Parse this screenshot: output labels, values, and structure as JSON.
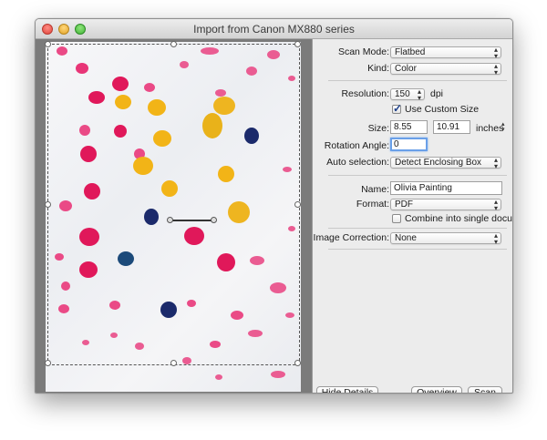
{
  "window": {
    "title": "Import from Canon MX880 series"
  },
  "settings": {
    "scan_mode": {
      "label": "Scan Mode:",
      "value": "Flatbed"
    },
    "kind": {
      "label": "Kind:",
      "value": "Color"
    },
    "resolution": {
      "label": "Resolution:",
      "value": "150",
      "unit": "dpi"
    },
    "use_custom_size": {
      "label": "Use Custom Size",
      "checked": true
    },
    "size": {
      "label": "Size:",
      "width": "8.55",
      "height": "10.91",
      "unit": "inches"
    },
    "rotation_angle": {
      "label": "Rotation Angle:",
      "value": "0"
    },
    "auto_selection": {
      "label": "Auto selection:",
      "value": "Detect Enclosing Box"
    },
    "name": {
      "label": "Name:",
      "value": "Olivia Painting"
    },
    "format": {
      "label": "Format:",
      "value": "PDF"
    },
    "combine": {
      "label": "Combine into single document",
      "checked": false
    },
    "image_correction": {
      "label": "Image Correction:",
      "value": "None"
    }
  },
  "buttons": {
    "hide_details": "Hide Details",
    "overview": "Overview",
    "scan": "Scan"
  },
  "icons": {
    "popup_arrows": "updown-chevron-icon",
    "stepper": "stepper-icon"
  },
  "colors": {
    "accent": "#6aa0e8",
    "paint_pink": "#e0185a",
    "paint_yellow": "#f2b417",
    "paint_navy": "#1b2a6b"
  }
}
